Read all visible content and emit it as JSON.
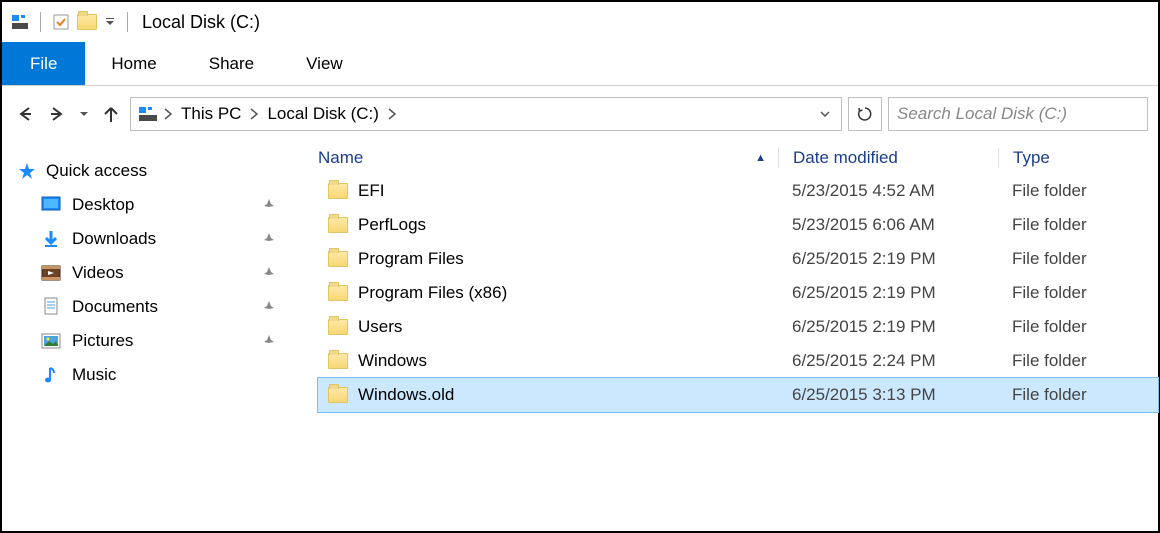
{
  "window_title": "Local Disk (C:)",
  "ribbon": {
    "file": "File",
    "home": "Home",
    "share": "Share",
    "view": "View"
  },
  "breadcrumbs": {
    "root": "This PC",
    "current": "Local Disk (C:)"
  },
  "search_placeholder": "Search Local Disk (C:)",
  "sidebar": {
    "quick_access": "Quick access",
    "items": [
      {
        "label": "Desktop",
        "icon": "desktop"
      },
      {
        "label": "Downloads",
        "icon": "downloads"
      },
      {
        "label": "Videos",
        "icon": "videos"
      },
      {
        "label": "Documents",
        "icon": "documents"
      },
      {
        "label": "Pictures",
        "icon": "pictures"
      },
      {
        "label": "Music",
        "icon": "music"
      }
    ]
  },
  "columns": {
    "name": "Name",
    "date": "Date modified",
    "type": "Type"
  },
  "files": [
    {
      "name": "EFI",
      "date": "5/23/2015 4:52 AM",
      "type": "File folder",
      "selected": false
    },
    {
      "name": "PerfLogs",
      "date": "5/23/2015 6:06 AM",
      "type": "File folder",
      "selected": false
    },
    {
      "name": "Program Files",
      "date": "6/25/2015 2:19 PM",
      "type": "File folder",
      "selected": false
    },
    {
      "name": "Program Files (x86)",
      "date": "6/25/2015 2:19 PM",
      "type": "File folder",
      "selected": false
    },
    {
      "name": "Users",
      "date": "6/25/2015 2:19 PM",
      "type": "File folder",
      "selected": false
    },
    {
      "name": "Windows",
      "date": "6/25/2015 2:24 PM",
      "type": "File folder",
      "selected": false
    },
    {
      "name": "Windows.old",
      "date": "6/25/2015 3:13 PM",
      "type": "File folder",
      "selected": true
    }
  ]
}
